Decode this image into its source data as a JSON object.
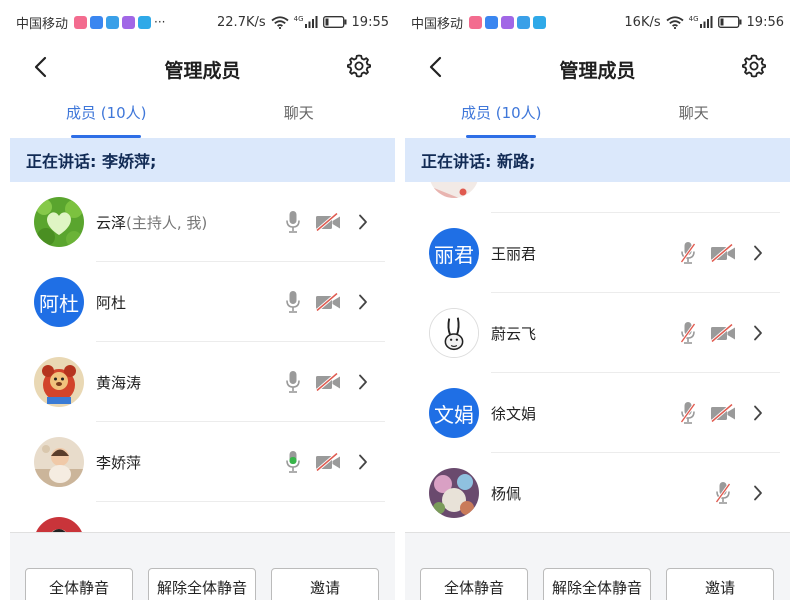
{
  "panels": [
    {
      "status": {
        "carrier": "中国移动",
        "dots": "···",
        "speed": "22.7K/s",
        "network": "4G",
        "time": "19:55"
      },
      "nav": {
        "title": "管理成员"
      },
      "tabs": [
        {
          "label": "成员 (10人)"
        },
        {
          "label": "聊天"
        }
      ],
      "speaking": "正在讲话: 李娇萍;",
      "members": [
        {
          "name": "云泽",
          "host_tag": "(主持人, 我)",
          "avatar_text": "",
          "avatar_kind": "heart-leaves"
        },
        {
          "name": "阿杜",
          "host_tag": "",
          "avatar_text": "阿杜",
          "avatar_kind": "text"
        },
        {
          "name": "黄海涛",
          "host_tag": "",
          "avatar_text": "",
          "avatar_kind": "cartoon-bear"
        },
        {
          "name": "李娇萍",
          "host_tag": "",
          "avatar_text": "",
          "avatar_kind": "baby-photo"
        },
        {
          "name": "",
          "host_tag": "",
          "avatar_text": "",
          "avatar_kind": "red-partial"
        }
      ],
      "buttons": {
        "mute_all": "全体静音",
        "unmute_all": "解除全体静音",
        "invite": "邀请"
      }
    },
    {
      "status": {
        "carrier": "中国移动",
        "dots": "",
        "speed": "16K/s",
        "network": "4G",
        "time": "19:56"
      },
      "nav": {
        "title": "管理成员"
      },
      "tabs": [
        {
          "label": "成员 (10人)"
        },
        {
          "label": "聊天"
        }
      ],
      "speaking": "正在讲话: 新路;",
      "members": [
        {
          "name": "",
          "host_tag": "",
          "avatar_text": "",
          "avatar_kind": "partial-top"
        },
        {
          "name": "王丽君",
          "host_tag": "",
          "avatar_text": "丽君",
          "avatar_kind": "text"
        },
        {
          "name": "蔚云飞",
          "host_tag": "",
          "avatar_text": "",
          "avatar_kind": "rabbit-sketch"
        },
        {
          "name": "徐文娟",
          "host_tag": "",
          "avatar_text": "文娟",
          "avatar_kind": "text"
        },
        {
          "name": "杨佩",
          "host_tag": "",
          "avatar_text": "",
          "avatar_kind": "photo-colorful"
        }
      ],
      "buttons": {
        "mute_all": "全体静音",
        "unmute_all": "解除全体静音",
        "invite": "邀请"
      }
    }
  ],
  "colors": {
    "accent": "#2e6ee6",
    "speaking_bg": "#dbe8fb",
    "mic_active": "#38b54a",
    "mic_muted_slash": "#e05a4f",
    "icon_gray": "#9a9a9a",
    "avatar_blue": "#1f6fe5"
  }
}
